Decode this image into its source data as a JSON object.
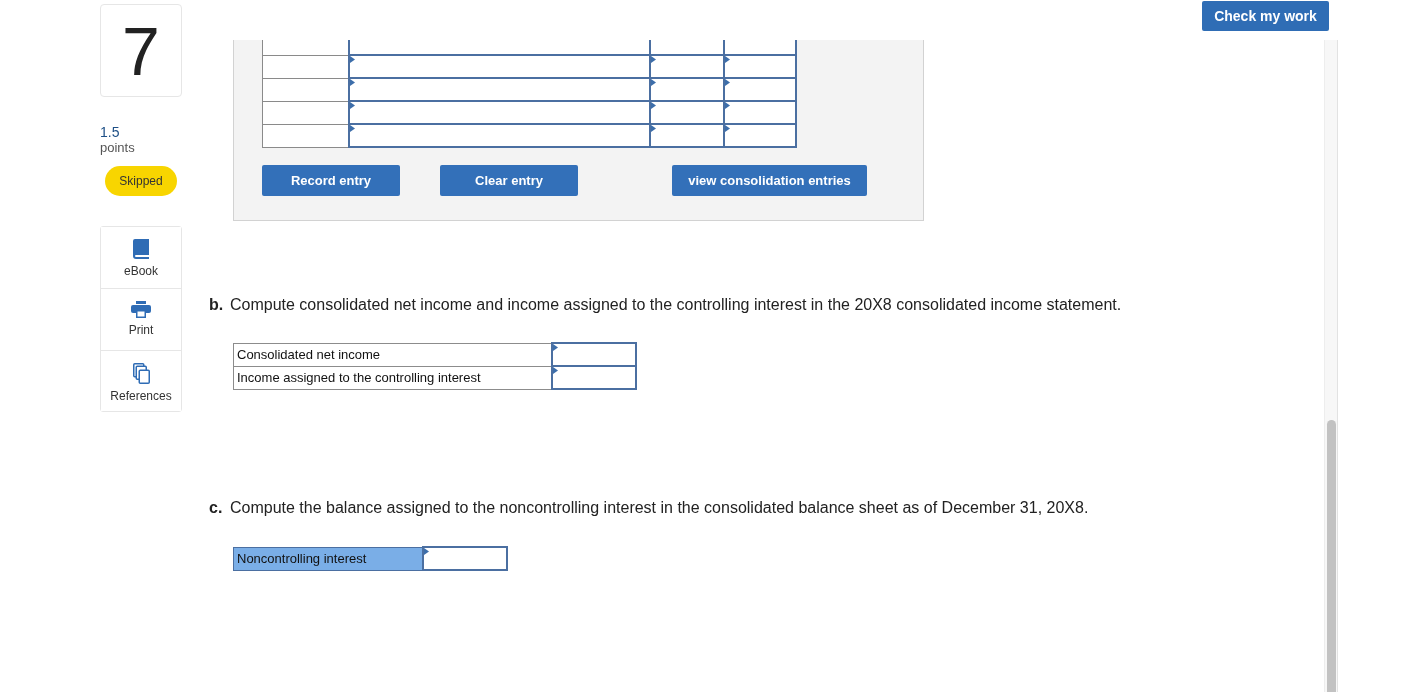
{
  "question": {
    "number": "7",
    "points": "1.5",
    "points_label": "points",
    "status": "Skipped"
  },
  "tools": [
    {
      "label": "eBook",
      "kind": "ebook"
    },
    {
      "label": "Print",
      "kind": "print"
    },
    {
      "label": "References",
      "kind": "references"
    }
  ],
  "header": {
    "check_button": "Check my work"
  },
  "journal_panel": {
    "buttons": [
      "Record entry",
      "Clear entry",
      "view consolidation entries"
    ]
  },
  "part_b": {
    "marker": "b.",
    "prompt": "Compute consolidated net income and income assigned to the controlling interest in the 20X8 consolidated income statement.",
    "rows": [
      {
        "label": "Consolidated net income",
        "highlighted": false
      },
      {
        "label": "Income assigned to the controlling interest",
        "highlighted": false
      }
    ]
  },
  "part_c": {
    "marker": "c.",
    "prompt": "Compute the balance assigned to the noncontrolling interest in the consolidated balance sheet as of December 31, 20X8.",
    "rows": [
      {
        "label": "Noncontrolling interest",
        "highlighted": true
      }
    ]
  }
}
